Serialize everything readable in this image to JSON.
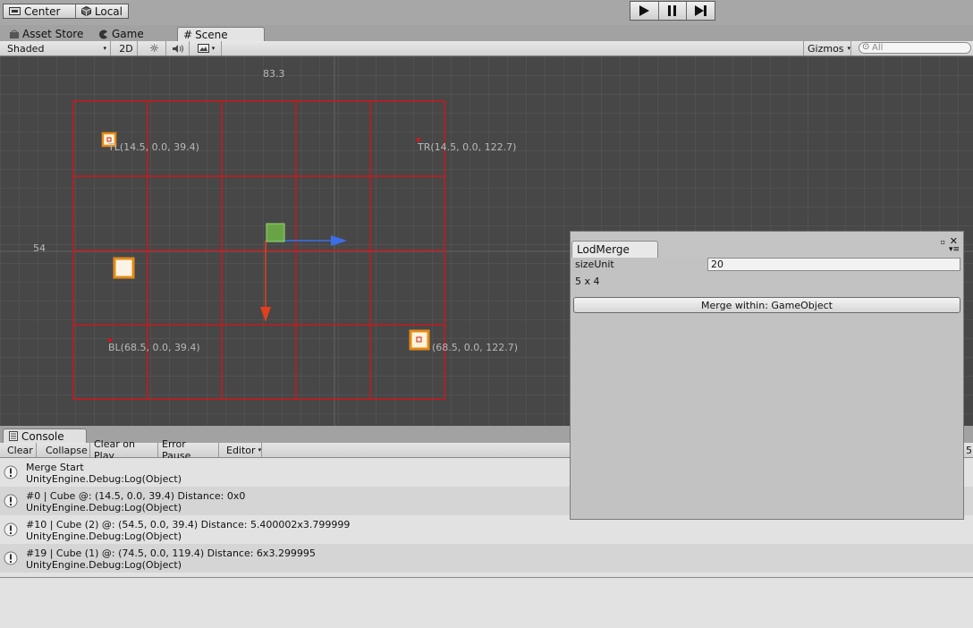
{
  "toolbar": {
    "pivot_label": "Center",
    "rotation_label": "Local"
  },
  "tabs": [
    {
      "label": "Asset Store",
      "icon": "shopping-bag-icon"
    },
    {
      "label": "Game",
      "icon": "pacman-icon"
    },
    {
      "label": "Scene",
      "icon": "grid-icon"
    }
  ],
  "scene_toolbar": {
    "draw_mode": "Shaded",
    "mode_2d": "2D",
    "gizmos_label": "Gizmos",
    "search_placeholder": "All"
  },
  "scene": {
    "top_value": "83.3",
    "left_value": "54",
    "labels": {
      "tl": "TL(14.5, 0.0, 39.4)",
      "tr": "TR(14.5, 0.0, 122.7)",
      "bl": "BL(68.5, 0.0, 39.4)",
      "br_suffix": "(68.5, 0.0, 122.7)"
    },
    "colors": {
      "grid_red": "#c8191d",
      "x_axis": "#3b6ee8",
      "z_axis": "#e0401e",
      "selected": "#6fb547"
    }
  },
  "console": {
    "tab_label": "Console",
    "buttons": [
      "Clear",
      "Collapse",
      "Clear on Play",
      "Error Pause",
      "Editor"
    ],
    "count_fragment": "5",
    "entries": [
      {
        "line1": "Merge Start",
        "line2": "UnityEngine.Debug:Log(Object)"
      },
      {
        "line1": "#0 | Cube @: (14.5, 0.0, 39.4) Distance: 0x0",
        "line2": "UnityEngine.Debug:Log(Object)"
      },
      {
        "line1": "#10 | Cube (2) @: (54.5, 0.0, 39.4) Distance: 5.400002x3.799999",
        "line2": "UnityEngine.Debug:Log(Object)"
      },
      {
        "line1": "#19 | Cube (1) @: (74.5, 0.0, 119.4) Distance: 6x3.299995",
        "line2": "UnityEngine.Debug:Log(Object)"
      }
    ]
  },
  "lodmerge": {
    "tab_label": "LodMerge",
    "size_label": "sizeUnit",
    "size_value": "20",
    "grid_info": "5 x 4",
    "merge_button": "Merge within: GameObject"
  }
}
